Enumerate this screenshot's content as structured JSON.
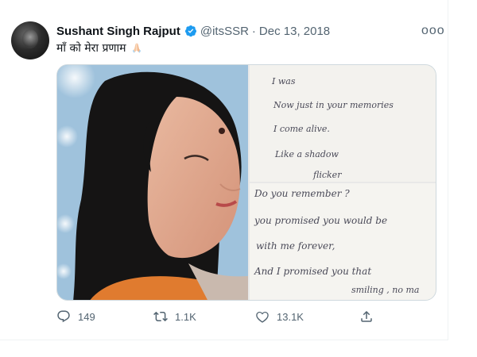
{
  "author": {
    "display_name": "Sushant Singh Rajput",
    "handle": "@itsSSR",
    "separator": "·",
    "date": "Dec 13, 2018"
  },
  "more_label": "ooo",
  "tweet": {
    "text": "माँ को मेरा प्रणाम",
    "emoji": "pray-emoji"
  },
  "media": {
    "note_top_lines": [
      "I was",
      "Now just in your memories",
      "I come alive.",
      "Like a shadow",
      "flicker"
    ],
    "note_bottom_lines": [
      "Do you remember ?",
      "you promised you would be",
      "with me forever,",
      "And I promised you that",
      "smiling , no ma"
    ]
  },
  "actions": {
    "reply_count": "149",
    "retweet_count": "1.1K",
    "like_count": "13.1K"
  },
  "icons": {
    "verified": "verified-badge-icon",
    "reply": "reply-icon",
    "retweet": "retweet-icon",
    "like": "heart-icon",
    "share": "share-icon"
  },
  "colors": {
    "verified_blue": "#1d9bf0",
    "secondary_text": "#536471"
  }
}
